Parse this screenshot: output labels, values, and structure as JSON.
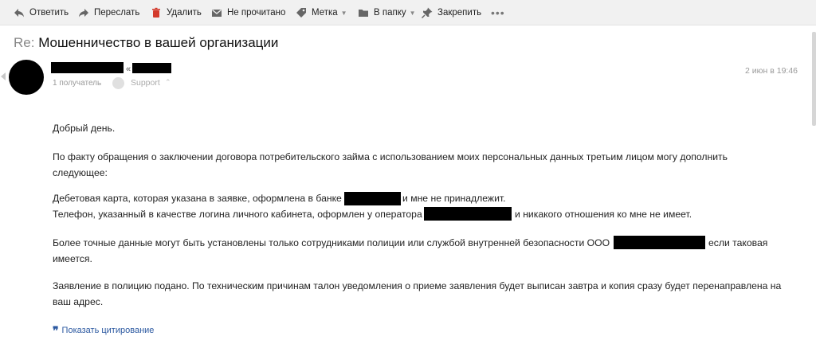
{
  "toolbar": {
    "reply": "Ответить",
    "forward": "Переслать",
    "delete": "Удалить",
    "unread": "Не прочитано",
    "label": "Метка",
    "folder": "В папку",
    "pin": "Закрепить",
    "more": "•••"
  },
  "message": {
    "subject_prefix": "Re:",
    "subject": "Мошенничество в вашей организации",
    "sender_sep": "«",
    "recipients_count": "1 получатель",
    "recipient_name": "Support",
    "recipient_toggle": "⌃",
    "date": "2 июн в 19:46"
  },
  "body": {
    "greeting": "Добрый день.",
    "p1_line1": "По факту обращения о заключении договора потребительского займа с использованием моих персональных данных третьим лицом могу дополнить",
    "p1_line2": "следующее:",
    "p2_line1_a": "Дебетовая карта, которая указана в заявке, оформлена в банке",
    "p2_line1_b": "и мне не принадлежит.",
    "p2_line2_a": "Телефон, указанный в качестве логина личного кабинета, оформлен у оператора",
    "p2_line2_b": "и никакого отношения ко мне не имеет.",
    "p3_line1_a": "Более точные данные могут быть установлены только сотрудниками полиции или службой внутренней безопасности ООО",
    "p3_line1_b": "если таковая",
    "p3_line2": "имеется.",
    "p4_line1": "Заявление в полицию подано. По техническим причинам талон уведомления о приеме заявления будет выписан завтра и копия сразу будет перенаправлена на",
    "p4_line2": "ваш адрес."
  },
  "quote": {
    "mark": "❞",
    "label": "Показать цитирование"
  },
  "icons": {
    "reply": "reply-icon",
    "forward": "forward-icon",
    "delete": "delete-icon",
    "unread": "envelope-icon",
    "label": "tag-icon",
    "folder": "folder-icon",
    "pin": "pin-icon"
  },
  "colors": {
    "delete_icon": "#d33a2c",
    "link": "#2b58a0",
    "toolbar_bg": "#f1f1f1"
  }
}
